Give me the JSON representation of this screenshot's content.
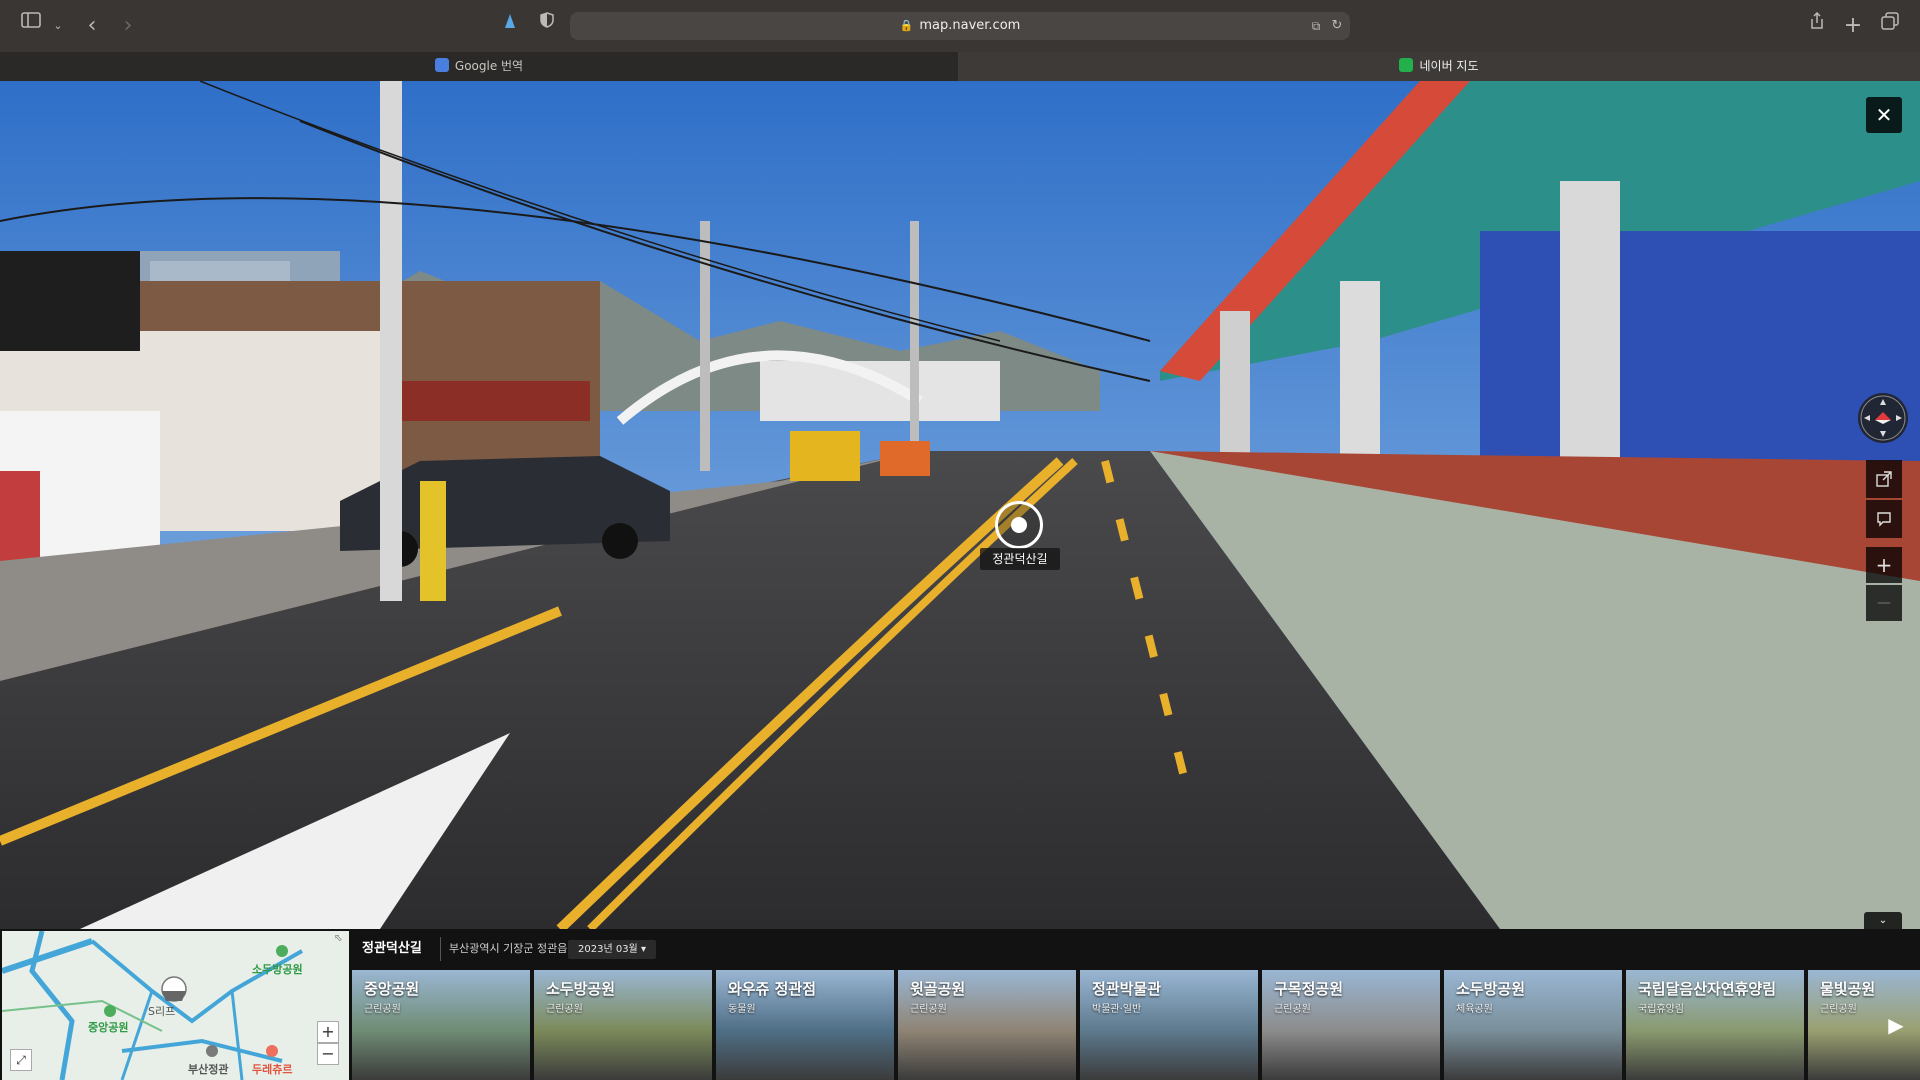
{
  "browser": {
    "url": "map.naver.com",
    "tabs": [
      {
        "label": "Google 번역",
        "active": false
      },
      {
        "label": "네이버 지도",
        "active": true
      }
    ]
  },
  "streetview": {
    "poi_label": "정관덕산길",
    "close_icon": "close-icon",
    "zoom_in": "+",
    "zoom_out": "—"
  },
  "location": {
    "title": "정관덕산길",
    "address": "부산광역시 기장군 정관읍",
    "date": "2023년 03월"
  },
  "minimap": {
    "labels": [
      "소두방공원",
      "중앙공원",
      "S리프",
      "부산정관",
      "두레츄르"
    ],
    "zoom_in": "+",
    "zoom_out": "−"
  },
  "places": [
    {
      "name": "중앙공원",
      "category": "근린공원",
      "color": "#6f8c74"
    },
    {
      "name": "소두방공원",
      "category": "근린공원",
      "color": "#7b8a5a"
    },
    {
      "name": "와우쥬 정관점",
      "category": "동물원",
      "color": "#4f6f86"
    },
    {
      "name": "윗골공원",
      "category": "근린공원",
      "color": "#8f8474"
    },
    {
      "name": "정관박물관",
      "category": "박물관·일반",
      "color": "#5d7a8e"
    },
    {
      "name": "구목정공원",
      "category": "근린공원",
      "color": "#8c8c8c"
    },
    {
      "name": "소두방공원",
      "category": "체육공원",
      "color": "#7a8f9a"
    },
    {
      "name": "국립달음산자연휴양림",
      "category": "국립휴양림",
      "color": "#8a9a6f"
    },
    {
      "name": "물빛공원",
      "category": "근린공원",
      "color": "#9aa070"
    }
  ],
  "colors": {
    "sky": "#3f7fd2",
    "road": "#3b3b3d",
    "lane_yellow": "#e9b02c",
    "station_red": "#c8402f"
  }
}
